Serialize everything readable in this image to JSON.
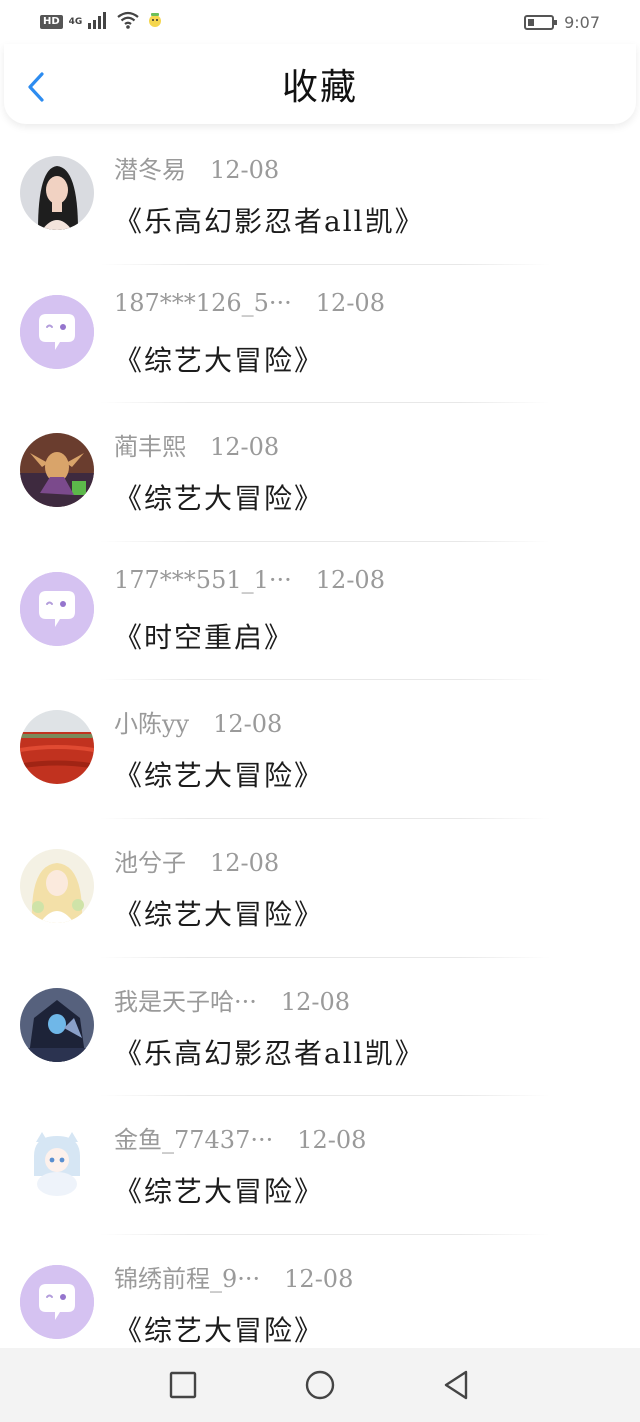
{
  "status_bar": {
    "hd_label": "HD",
    "network_label": "4G",
    "time": "9:07",
    "battery_level": 0.4
  },
  "header": {
    "title": "收藏",
    "back_icon": "chevron-left-icon",
    "accent_color": "#2d8cf0"
  },
  "favorites": [
    {
      "user": "潜冬易",
      "date": "12-08",
      "title": "《乐高幻影忍者all凯》",
      "avatar": "photo-woman"
    },
    {
      "user": "187***126_5···",
      "date": "12-08",
      "title": "《综艺大冒险》",
      "avatar": "default"
    },
    {
      "user": "蔺丰熙",
      "date": "12-08",
      "title": "《综艺大冒险》",
      "avatar": "photo-game-character"
    },
    {
      "user": "177***551_1···",
      "date": "12-08",
      "title": "《时空重启》",
      "avatar": "default"
    },
    {
      "user": "小陈yy",
      "date": "12-08",
      "title": "《综艺大冒险》",
      "avatar": "photo-red-field"
    },
    {
      "user": "池兮子",
      "date": "12-08",
      "title": "《综艺大冒险》",
      "avatar": "photo-anime-girl"
    },
    {
      "user": "我是天子哈···",
      "date": "12-08",
      "title": "《乐高幻影忍者all凯》",
      "avatar": "photo-dark-figure"
    },
    {
      "user": "金鱼_77437···",
      "date": "12-08",
      "title": "《综艺大冒险》",
      "avatar": "photo-anime-cat"
    },
    {
      "user": "锦绣前程_9···",
      "date": "12-08",
      "title": "《综艺大冒险》",
      "avatar": "default"
    }
  ],
  "nav_bar": {
    "recent_icon": "square-icon",
    "home_icon": "circle-icon",
    "back_icon": "triangle-back-icon"
  }
}
